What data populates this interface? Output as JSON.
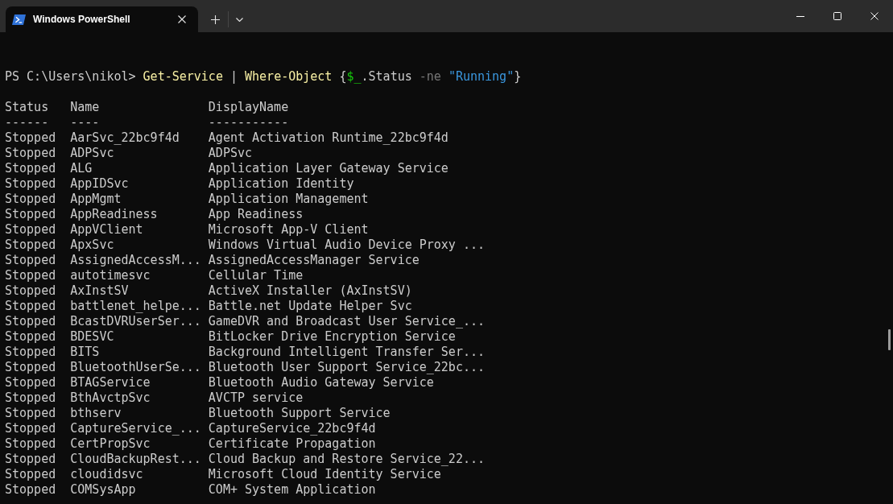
{
  "window": {
    "tabs": [
      {
        "title": "Windows PowerShell",
        "selected": true
      }
    ]
  },
  "terminal": {
    "command_line": [
      {
        "kind": "prompt",
        "text": "PS C:\\Users\\nikol> "
      },
      {
        "kind": "command",
        "text": "Get-Service"
      },
      {
        "kind": "plain",
        "text": " | "
      },
      {
        "kind": "command",
        "text": "Where-Object"
      },
      {
        "kind": "plain",
        "text": " {"
      },
      {
        "kind": "variable",
        "text": "$_"
      },
      {
        "kind": "plain",
        "text": ".Status "
      },
      {
        "kind": "parameter",
        "text": "-ne"
      },
      {
        "kind": "string",
        "text": " \"Running\""
      },
      {
        "kind": "plain",
        "text": "}"
      }
    ],
    "table": {
      "columns": [
        "Status",
        "Name",
        "DisplayName"
      ],
      "underlines": [
        "------",
        "----",
        "-----------"
      ],
      "rows": [
        {
          "status": "Stopped",
          "name": "AarSvc_22bc9f4d",
          "display_name": "Agent Activation Runtime_22bc9f4d"
        },
        {
          "status": "Stopped",
          "name": "ADPSvc",
          "display_name": "ADPSvc"
        },
        {
          "status": "Stopped",
          "name": "ALG",
          "display_name": "Application Layer Gateway Service"
        },
        {
          "status": "Stopped",
          "name": "AppIDSvc",
          "display_name": "Application Identity"
        },
        {
          "status": "Stopped",
          "name": "AppMgmt",
          "display_name": "Application Management"
        },
        {
          "status": "Stopped",
          "name": "AppReadiness",
          "display_name": "App Readiness"
        },
        {
          "status": "Stopped",
          "name": "AppVClient",
          "display_name": "Microsoft App-V Client"
        },
        {
          "status": "Stopped",
          "name": "ApxSvc",
          "display_name": "Windows Virtual Audio Device Proxy ..."
        },
        {
          "status": "Stopped",
          "name": "AssignedAccessM...",
          "display_name": "AssignedAccessManager Service"
        },
        {
          "status": "Stopped",
          "name": "autotimesvc",
          "display_name": "Cellular Time"
        },
        {
          "status": "Stopped",
          "name": "AxInstSV",
          "display_name": "ActiveX Installer (AxInstSV)"
        },
        {
          "status": "Stopped",
          "name": "battlenet_helpe...",
          "display_name": "Battle.net Update Helper Svc"
        },
        {
          "status": "Stopped",
          "name": "BcastDVRUserSer...",
          "display_name": "GameDVR and Broadcast User Service_..."
        },
        {
          "status": "Stopped",
          "name": "BDESVC",
          "display_name": "BitLocker Drive Encryption Service"
        },
        {
          "status": "Stopped",
          "name": "BITS",
          "display_name": "Background Intelligent Transfer Ser..."
        },
        {
          "status": "Stopped",
          "name": "BluetoothUserSe...",
          "display_name": "Bluetooth User Support Service_22bc..."
        },
        {
          "status": "Stopped",
          "name": "BTAGService",
          "display_name": "Bluetooth Audio Gateway Service"
        },
        {
          "status": "Stopped",
          "name": "BthAvctpSvc",
          "display_name": "AVCTP service"
        },
        {
          "status": "Stopped",
          "name": "bthserv",
          "display_name": "Bluetooth Support Service"
        },
        {
          "status": "Stopped",
          "name": "CaptureService_...",
          "display_name": "CaptureService_22bc9f4d"
        },
        {
          "status": "Stopped",
          "name": "CertPropSvc",
          "display_name": "Certificate Propagation"
        },
        {
          "status": "Stopped",
          "name": "CloudBackupRest...",
          "display_name": "Cloud Backup and Restore Service_22..."
        },
        {
          "status": "Stopped",
          "name": "cloudidsvc",
          "display_name": "Microsoft Cloud Identity Service"
        },
        {
          "status": "Stopped",
          "name": "COMSysApp",
          "display_name": "COM+ System Application"
        }
      ]
    }
  }
}
